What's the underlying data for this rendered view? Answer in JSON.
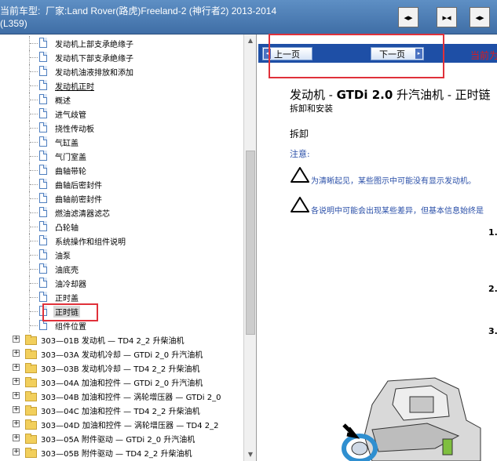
{
  "header": {
    "title": "当前车型:  厂家:Land Rover(路虎)Freeland-2 (神行者2) 2013-2014 (L359)",
    "buttons": [
      {
        "name": "expand-right-button",
        "glyph": "◂▸"
      },
      {
        "name": "expand-both-button",
        "glyph": "▸◂"
      },
      {
        "name": "collapse-left-button",
        "glyph": "◂▸"
      }
    ]
  },
  "tree": {
    "doc_items": [
      {
        "label": "发动机上部支承绝缘子"
      },
      {
        "label": "发动机下部支承绝缘子"
      },
      {
        "label": "发动机油液排放和添加"
      },
      {
        "label": "发动机正时",
        "underline": true
      },
      {
        "label": "概述"
      },
      {
        "label": "进气歧管"
      },
      {
        "label": "挠性传动板"
      },
      {
        "label": "气缸盖"
      },
      {
        "label": "气门室盖"
      },
      {
        "label": "曲轴带轮"
      },
      {
        "label": "曲轴后密封件"
      },
      {
        "label": "曲轴前密封件"
      },
      {
        "label": "燃油滤清器滤芯"
      },
      {
        "label": "凸轮轴"
      },
      {
        "label": "系统操作和组件说明"
      },
      {
        "label": "油泵"
      },
      {
        "label": "油底壳"
      },
      {
        "label": "油冷却器"
      },
      {
        "label": "正时盖"
      },
      {
        "label": "正时链",
        "selected": true
      },
      {
        "label": "组件位置"
      }
    ],
    "folder_items": [
      {
        "label": "303—01B 发动机 — TD4 2_2 升柴油机"
      },
      {
        "label": "303—03A 发动机冷却 — GTDi 2_0 升汽油机"
      },
      {
        "label": "303—03B 发动机冷却 — TD4 2_2 升柴油机"
      },
      {
        "label": "303—04A 加油和控件 — GTDi 2_0 升汽油机"
      },
      {
        "label": "303—04B 加油和控件 — 涡轮增压器 — GTDi 2_0"
      },
      {
        "label": "303—04C 加油和控件 — TD4 2_2 升柴油机"
      },
      {
        "label": "303—04D 加油和控件 — 涡轮增压器 — TD4 2_2"
      },
      {
        "label": "303—05A 附件驱动 — GTDi 2_0 升汽油机"
      },
      {
        "label": "303—05B 附件驱动 — TD4 2_2 升柴油机"
      }
    ],
    "expander_glyph": "+"
  },
  "navigation": {
    "prev_label": "上一页",
    "next_label": "下一页",
    "current_label": "当前为"
  },
  "document": {
    "title_prefix": "发动机 - ",
    "title_engine": "GTDi 2.0",
    "title_suffix": " 升汽油机 - 正时链",
    "subtitle": "拆卸和安装",
    "section": "拆卸",
    "note_label": "注意:",
    "warnings": [
      "为清晰起见，某些图示中可能没有显示发动机。",
      "各说明中可能会出现某些差异，但基本信息始终是"
    ],
    "steps": [
      "1.",
      "2.",
      "3."
    ]
  },
  "colors": {
    "header_bg": "#4f80b8",
    "nav_bg": "#1e4fa6",
    "highlight_red": "#e0313a",
    "note_blue": "#2a4fa8"
  }
}
